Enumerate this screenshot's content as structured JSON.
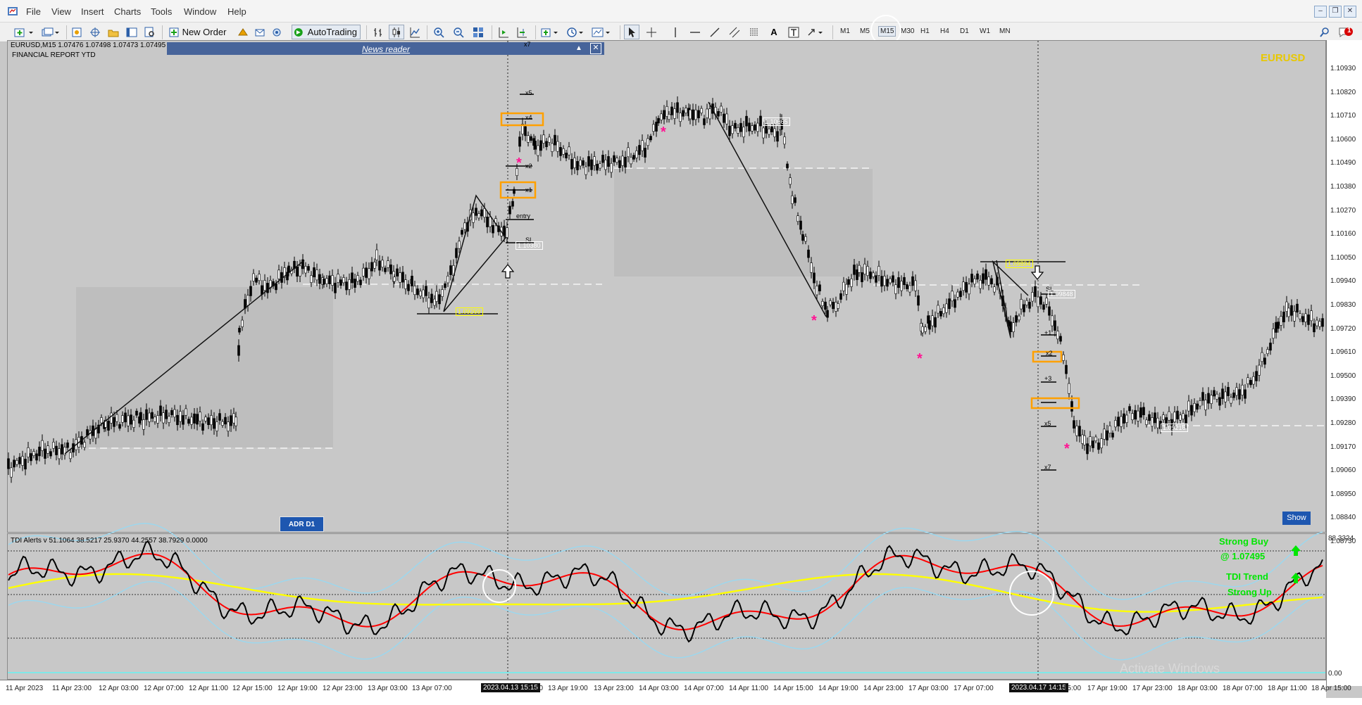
{
  "menu": {
    "items": [
      "File",
      "View",
      "Insert",
      "Charts",
      "Tools",
      "Window",
      "Help"
    ]
  },
  "window_controls": [
    "minimize",
    "restore",
    "close"
  ],
  "toolbar": {
    "new_order_label": "New Order",
    "autotrading_label": "AutoTrading",
    "timeframes": [
      "M1",
      "M5",
      "M15",
      "M30",
      "H1",
      "H4",
      "D1",
      "W1",
      "MN"
    ],
    "active_timeframe": "M15",
    "notification_count": "1"
  },
  "chart": {
    "header": "EURUSD,M15  1.07476 1.07498 1.07473 1.07495",
    "report_label": "FINANCIAL REPORT YTD",
    "symbol_watermark": "EURUSD",
    "news_reader_title": "News reader",
    "adr_button": "ADR D1",
    "show_button": "Show",
    "price_axis": [
      "1.10930",
      "1.10820",
      "1.10710",
      "1.10600",
      "1.10490",
      "1.10380",
      "1.10270",
      "1.10160",
      "1.10050",
      "1.09940",
      "1.09830",
      "1.09720",
      "1.09610",
      "1.09500",
      "1.09390",
      "1.09280",
      "1.09170",
      "1.09060",
      "1.08950",
      "1.08840",
      "1.08730"
    ],
    "price_labels": [
      "1.10665",
      "1.10380",
      "1.09269",
      "1.09894",
      "1.09848",
      "1.09216"
    ],
    "level_labels": [
      "x7",
      "x5",
      "x4",
      "x2",
      "x1",
      "entry",
      "SL",
      "x7",
      "x5",
      "+3",
      "x2",
      "+1",
      "SL"
    ]
  },
  "time_axis": {
    "labels": [
      "11 Apr 2023",
      "11 Apr 23:00",
      "12 Apr 03:00",
      "12 Apr 07:00",
      "12 Apr 11:00",
      "12 Apr 15:00",
      "12 Apr 19:00",
      "12 Apr 23:00",
      "13 Apr 03:00",
      "13 Apr 07:00",
      "13 Apr 19:00",
      "13 Apr 23:00",
      "14 Apr 03:00",
      "14 Apr 07:00",
      "14 Apr 11:00",
      "14 Apr 15:00",
      "14 Apr 19:00",
      "14 Apr 23:00",
      "17 Apr 03:00",
      "17 Apr 07:00",
      "17 Apr 19:00",
      "17 Apr 23:00",
      "18 Apr 03:00",
      "18 Apr 07:00",
      "18 Apr 11:00",
      "18 Apr 15:00"
    ],
    "cursor_label_1": "2023.04.13 15:15",
    "cursor_label_1_suffix": "00",
    "cursor_label_2": "2023.04.17 14:15",
    "cursor_label_2_suffix": "15:00"
  },
  "indicator": {
    "header": "TDI Alerts v 51.1064 38.5217 25.9370 44.2557 38.7929 0.0000",
    "axis_top": "88.3324",
    "axis_bottom": "0.00",
    "signal_strong_buy": "Strong Buy",
    "signal_price": "@ 1.07495",
    "signal_trend": "TDI Trend",
    "signal_strong_up": "Strong Up"
  },
  "watermark": "Activate Windows",
  "colors": {
    "accent_blue": "#1e57b0",
    "news_bar": "#47649a",
    "rsi_line": "#ff0000",
    "price_line": "#000000",
    "signal_line": "#ffff00",
    "band_line": "#9ad8f0",
    "signal_text": "#00e600",
    "highlight_box": "#ffa000"
  }
}
